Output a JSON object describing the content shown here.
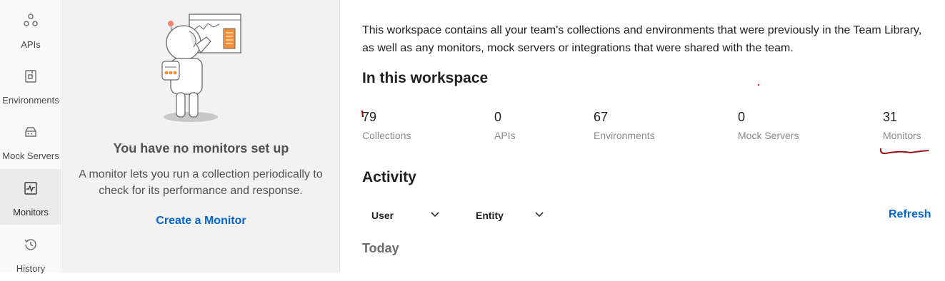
{
  "sidebar": {
    "items": [
      {
        "label": "APIs",
        "icon": "apis-icon",
        "active": false
      },
      {
        "label": "Environments",
        "icon": "environment-icon",
        "active": false
      },
      {
        "label": "Mock Servers",
        "icon": "mock-server-icon",
        "active": false
      },
      {
        "label": "Monitors",
        "icon": "monitor-icon",
        "active": true
      },
      {
        "label": "History",
        "icon": "history-icon",
        "active": false
      }
    ]
  },
  "empty_state": {
    "title": "You have no monitors set up",
    "description": "A monitor lets you run a collection periodically to check for its performance and response.",
    "action_label": "Create a Monitor"
  },
  "workspace": {
    "intro": "This workspace contains all your team's collections and environments that were previously in the Team Library, as well as any monitors, mock servers or integrations that were shared with the team.",
    "heading": "In this workspace",
    "stats": [
      {
        "count": "79",
        "label": "Collections"
      },
      {
        "count": "0",
        "label": "APIs"
      },
      {
        "count": "67",
        "label": "Environments"
      },
      {
        "count": "0",
        "label": "Mock Servers"
      },
      {
        "count": "31",
        "label": "Monitors"
      }
    ]
  },
  "activity": {
    "heading": "Activity",
    "filters": [
      {
        "label": "User"
      },
      {
        "label": "Entity"
      }
    ],
    "refresh_label": "Refresh",
    "group_label": "Today"
  },
  "colors": {
    "link": "#0265d2",
    "accent_orange": "#f68f36",
    "annotation_red": "#9b0d12"
  }
}
